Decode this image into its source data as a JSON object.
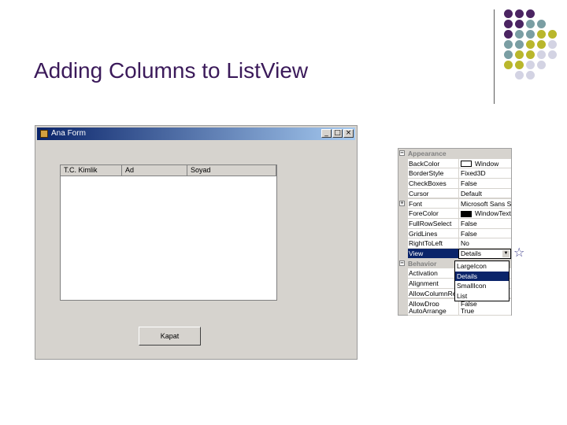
{
  "slide": {
    "title": "Adding Columns to ListView"
  },
  "colors": {
    "title": "#3b1a5a",
    "purple": "#4b2462",
    "teal": "#7a9ea3",
    "olive": "#b9b72c",
    "lavender": "#d3d3e3"
  },
  "form": {
    "title": "Ana Form",
    "minimize": "_",
    "maximize": "□",
    "close": "×",
    "columns": [
      "T.C. Kimlik",
      "Ad",
      "Soyad"
    ],
    "button_label": "Kapat"
  },
  "properties": {
    "categories": {
      "appearance": "Appearance",
      "behavior": "Behavior"
    },
    "rows": [
      {
        "name": "BackColor",
        "value": "Window"
      },
      {
        "name": "BorderStyle",
        "value": "Fixed3D"
      },
      {
        "name": "CheckBoxes",
        "value": "False"
      },
      {
        "name": "Cursor",
        "value": "Default"
      },
      {
        "name": "Font",
        "value": "Microsoft Sans Se"
      },
      {
        "name": "ForeColor",
        "value": "WindowText"
      },
      {
        "name": "FullRowSelect",
        "value": "False"
      },
      {
        "name": "GridLines",
        "value": "False"
      },
      {
        "name": "RightToLeft",
        "value": "No"
      },
      {
        "name": "View",
        "value": "Details"
      }
    ],
    "behavior_rows": [
      {
        "name": "Activation"
      },
      {
        "name": "Alignment"
      },
      {
        "name": "AllowColumnRe"
      },
      {
        "name": "AllowDrop",
        "value": "False"
      },
      {
        "name": "AutoArrange",
        "value": "True"
      }
    ],
    "expand_minus": "−",
    "expand_plus": "+",
    "view_options": [
      "LargeIcon",
      "Details",
      "SmallIcon",
      "List"
    ]
  },
  "decor": {
    "star": "☆"
  }
}
